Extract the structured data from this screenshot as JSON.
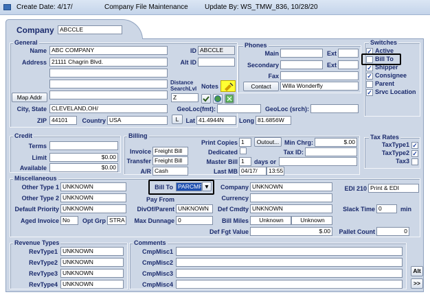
{
  "titlebar": {
    "create": "Create Date: 4/17/",
    "title": "Company File Maintenance",
    "update": "Update By: WS_TMW_836, 10/28/20"
  },
  "company": {
    "label": "Company",
    "value": "ABCCLE"
  },
  "general": {
    "title": "General",
    "name_label": "Name",
    "name": "ABC COMPANY",
    "id_label": "ID",
    "id": "ABCCLE",
    "address_label": "Address",
    "address1": "21111 Chagrin Blvd.",
    "address2": "",
    "address3": "",
    "address4": "",
    "altid_label": "Alt ID",
    "altid": "",
    "distance_label": "Distance",
    "searchlvl_label": "SearchLvl",
    "searchlvl": "Z",
    "notes_label": "Notes",
    "mapaddr_btn": "Map Addr",
    "citystate_label": "City, State",
    "citystate": "CLEVELAND,OH/",
    "geoloc_label": "GeoLoc(fmt):",
    "geoloc": "",
    "geolocsrch_label": "GeoLoc (srch):",
    "geolocsrch": "",
    "zip_label": "ZIP",
    "zip": "44101",
    "country_label": "Country",
    "country": "USA",
    "l_btn": "L",
    "lat_label": "Lat",
    "lat": "41.4944N",
    "long_label": "Long",
    "long": "81.6856W"
  },
  "phones": {
    "title": "Phones",
    "main_label": "Main",
    "main": "",
    "ext_label": "Ext",
    "ext1": "",
    "secondary_label": "Secondary",
    "secondary": "",
    "ext2": "",
    "fax_label": "Fax",
    "fax": "",
    "contact_btn": "Contact",
    "contact": "Willa Wonderfly"
  },
  "switches": {
    "title": "Switches",
    "items": [
      {
        "label": "Active",
        "checked": true
      },
      {
        "label": "Bill To",
        "checked": false
      },
      {
        "label": "Shipper",
        "checked": true
      },
      {
        "label": "Consignee",
        "checked": true
      },
      {
        "label": "Parent",
        "checked": false
      },
      {
        "label": "Srvc Location",
        "checked": true
      }
    ]
  },
  "credit": {
    "title": "Credit",
    "terms_label": "Terms",
    "terms": "",
    "limit_label": "Limit",
    "limit": "$0.00",
    "available_label": "Available",
    "available": "$0.00"
  },
  "billing": {
    "title": "Billing",
    "invoice_label": "Invoice",
    "invoice": "Freight Bill",
    "transfer_label": "Transfer",
    "transfer": "Freight Bill",
    "ar_label": "A/R",
    "ar": "Cash",
    "printcopies_label": "Print Copies",
    "printcopies": "1",
    "outout_btn": "Outout...",
    "minchrg_label": "Min Chrg:",
    "minchrg": "$.00",
    "dedicated_label": "Dedicated",
    "taxid_label": "Tax ID:",
    "taxid": "",
    "masterbill_label": "Master Bill",
    "masterbill": "1",
    "daysor_label": "days or",
    "daysor": "",
    "lastmb_label": "Last MB",
    "lastmb_date": "04/17/",
    "lastmb_time": "13:55"
  },
  "taxrates": {
    "title": "Tax Rates",
    "items": [
      {
        "label": "TaxType1",
        "checked": true
      },
      {
        "label": "TaxType2",
        "checked": true
      },
      {
        "label": "Tax3",
        "checked": false
      }
    ]
  },
  "misc": {
    "title": "Miscellaneous",
    "other1_label": "Other Type 1",
    "other1": "UNKNOWN",
    "other2_label": "Other Type 2",
    "other2": "UNKNOWN",
    "defpriority_label": "Default Priority",
    "defpriority": "UNKNOWN",
    "agedinv_label": "Aged Invoice",
    "agedinv": "No",
    "optgrp_label": "Opt Grp",
    "optgrp": "STRA",
    "billto_label": "Bill To",
    "billto": "PARCMF",
    "payfrom_label": "Pay From",
    "divof_label": "DivOf/Parent",
    "divof": "UNKNOWN",
    "maxdunnage_label": "Max Dunnage",
    "maxdunnage": "0",
    "company_label": "Company",
    "company": "UNKNOWN",
    "currency_label": "Currency",
    "currency": "",
    "defcmdty_label": "Def Cmdty",
    "defcmdty": "UNKNOWN",
    "billmiles_label": "Bill Miles",
    "billmiles1": "Unknown",
    "billmiles2": "Unknown",
    "deffgt_label": "Def Fgt Value",
    "deffgt": "$.00",
    "edi_label": "EDI 210",
    "edi": "Print & EDI",
    "slack_label": "Slack Time",
    "slack": "0",
    "slack_unit": "min",
    "pallet_label": "Pallet Count",
    "pallet": "0"
  },
  "revenue": {
    "title": "Revenue Types",
    "items": [
      {
        "label": "RevType1",
        "value": "UNKNOWN"
      },
      {
        "label": "RevType2",
        "value": "UNKNOWN"
      },
      {
        "label": "RevType3",
        "value": "UNKNOWN"
      },
      {
        "label": "RevType4",
        "value": "UNKNOWN"
      }
    ]
  },
  "comments": {
    "title": "Comments",
    "items": [
      {
        "label": "CmpMisc1",
        "value": ""
      },
      {
        "label": "CmpMisc2",
        "value": ""
      },
      {
        "label": "CmpMisc3",
        "value": ""
      },
      {
        "label": "CmpMisc4",
        "value": ""
      }
    ]
  },
  "buttons": {
    "alt": "Alt",
    "next": ">>"
  }
}
